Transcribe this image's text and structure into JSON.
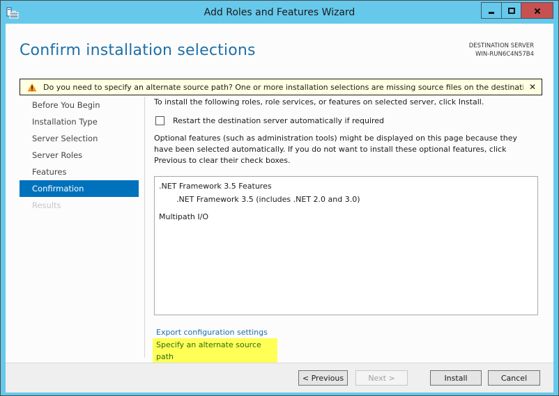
{
  "window": {
    "title": "Add Roles and Features Wizard",
    "app_icon": "server-manager-icon",
    "controls": {
      "minimize": "minimize-icon",
      "maximize": "maximize-icon",
      "close": "close-icon"
    }
  },
  "header": {
    "page_title": "Confirm installation selections",
    "destination_label": "DESTINATION SERVER",
    "destination_server": "WIN-RUN6C4N57B4"
  },
  "warning": {
    "icon": "warning-icon",
    "text": "Do you need to specify an alternate source path? One or more installation selections are missing source files on the destinati...",
    "close": "✕"
  },
  "sidebar": {
    "items": [
      {
        "label": "Before You Begin",
        "state": "normal"
      },
      {
        "label": "Installation Type",
        "state": "normal"
      },
      {
        "label": "Server Selection",
        "state": "normal"
      },
      {
        "label": "Server Roles",
        "state": "normal"
      },
      {
        "label": "Features",
        "state": "normal"
      },
      {
        "label": "Confirmation",
        "state": "active"
      },
      {
        "label": "Results",
        "state": "disabled"
      }
    ]
  },
  "content": {
    "intro": "To install the following roles, role services, or features on selected server, click Install.",
    "restart_checkbox": {
      "label": "Restart the destination server automatically if required",
      "checked": false
    },
    "optional_note": "Optional features (such as administration tools) might be displayed on this page because they have been selected automatically. If you do not want to install these optional features, click Previous to clear their check boxes.",
    "selections": [
      {
        "label": ".NET Framework 3.5 Features",
        "level": 0
      },
      {
        "label": ".NET Framework 3.5 (includes .NET 2.0 and 3.0)",
        "level": 1
      },
      {
        "label": "Multipath I/O",
        "level": 0
      }
    ],
    "links": {
      "export": "Export configuration settings",
      "alternate_source": "Specify an alternate source path"
    }
  },
  "footer": {
    "previous": "< Previous",
    "next": "Next >",
    "install": "Install",
    "cancel": "Cancel"
  },
  "colors": {
    "frame": "#66c9eb",
    "accent": "#0072bc",
    "title_text": "#1e6fa8",
    "warning_bg": "#ffffe1",
    "highlight": "#ffff55",
    "close_button": "#c75050"
  }
}
